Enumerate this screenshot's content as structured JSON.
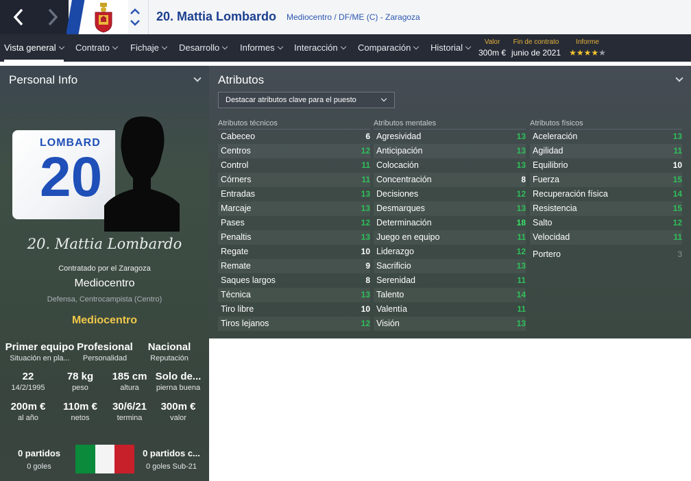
{
  "header": {
    "player_name": "20. Mattia Lombardo",
    "player_sub": "Mediocentro / DF/ME (C) - Zaragoza",
    "back_icon": "chevron-left-icon",
    "forward_icon": "chevron-right-icon",
    "crest_icon": "club-crest-icon",
    "colors": {
      "club_blue": "#1b49a8",
      "name_blue": "#1b3f8f"
    }
  },
  "menu": {
    "items": [
      {
        "label": "Vista general",
        "active": true
      },
      {
        "label": "Contrato"
      },
      {
        "label": "Fichaje"
      },
      {
        "label": "Desarrollo"
      },
      {
        "label": "Informes"
      },
      {
        "label": "Interacción"
      },
      {
        "label": "Comparación"
      },
      {
        "label": "Historial"
      }
    ],
    "stats": {
      "valor_label": "Valor",
      "valor_value": "300m €",
      "contrato_label": "Fin de contrato",
      "contrato_value": "junio de 2021",
      "informe_label": "Informe",
      "informe_stars": 4,
      "informe_stars_max": 5
    }
  },
  "personal": {
    "title": "Personal Info",
    "kit_name": "LOMBARD",
    "kit_number": "20",
    "signature": "20. Mattia Lombardo",
    "contracted_by": "Contratado por el Zaragoza",
    "role": "Mediocentro",
    "positions": "Defensa, Centrocampista (Centro)",
    "best_role": "Mediocentro",
    "row1": [
      {
        "big": "Primer equipo",
        "small": "Situación en pla..."
      },
      {
        "big": "Profesional",
        "small": "Personalidad"
      },
      {
        "big": "Nacional",
        "small": "Reputación"
      }
    ],
    "row2": [
      {
        "big": "22",
        "small": "14/2/1995"
      },
      {
        "big": "78 kg",
        "small": "peso"
      },
      {
        "big": "185 cm",
        "small": "altura"
      },
      {
        "big": "Solo de...",
        "small": "pierna buena"
      }
    ],
    "row3": [
      {
        "big": "200m €",
        "small": "al año"
      },
      {
        "big": "110m €",
        "small": "netos"
      },
      {
        "big": "30/6/21",
        "small": "termina"
      },
      {
        "big": "300m €",
        "small": "valor"
      }
    ],
    "caps": {
      "big": "0 partidos",
      "small": "0 goles"
    },
    "youth_caps": {
      "big": "0 partidos c...",
      "small": "0 goles Sub-21"
    },
    "flag_colors": [
      "#0a8a3a",
      "#f4f4f4",
      "#c8202a"
    ],
    "flag_icon": "italy-flag-icon"
  },
  "attributes": {
    "title": "Atributos",
    "highlight_dropdown": "Destacar atributos clave para el puesto",
    "technical": {
      "heading": "Atributos técnicos",
      "rows": [
        {
          "name": "Cabeceo",
          "value": "6"
        },
        {
          "name": "Centros",
          "value": "12"
        },
        {
          "name": "Control",
          "value": "11"
        },
        {
          "name": "Córners",
          "value": "11"
        },
        {
          "name": "Entradas",
          "value": "13"
        },
        {
          "name": "Marcaje",
          "value": "13"
        },
        {
          "name": "Pases",
          "value": "12"
        },
        {
          "name": "Penaltis",
          "value": "13"
        },
        {
          "name": "Regate",
          "value": "10"
        },
        {
          "name": "Remate",
          "value": "9"
        },
        {
          "name": "Saques largos",
          "value": "8"
        },
        {
          "name": "Técnica",
          "value": "13"
        },
        {
          "name": "Tiro libre",
          "value": "10"
        },
        {
          "name": "Tiros lejanos",
          "value": "12"
        }
      ]
    },
    "mental": {
      "heading": "Atributos mentales",
      "rows": [
        {
          "name": "Agresividad",
          "value": "13"
        },
        {
          "name": "Anticipación",
          "value": "13"
        },
        {
          "name": "Colocación",
          "value": "13"
        },
        {
          "name": "Concentración",
          "value": "8"
        },
        {
          "name": "Decisiones",
          "value": "12"
        },
        {
          "name": "Desmarques",
          "value": "13"
        },
        {
          "name": "Determinación",
          "value": "18"
        },
        {
          "name": "Juego en equipo",
          "value": "11"
        },
        {
          "name": "Liderazgo",
          "value": "12"
        },
        {
          "name": "Sacrificio",
          "value": "13"
        },
        {
          "name": "Serenidad",
          "value": "11"
        },
        {
          "name": "Talento",
          "value": "14"
        },
        {
          "name": "Valentía",
          "value": "11"
        },
        {
          "name": "Visión",
          "value": "13"
        }
      ]
    },
    "physical": {
      "heading": "Atributos físicos",
      "rows": [
        {
          "name": "Aceleración",
          "value": "13"
        },
        {
          "name": "Agilidad",
          "value": "11"
        },
        {
          "name": "Equilibrio",
          "value": "10"
        },
        {
          "name": "Fuerza",
          "value": "15"
        },
        {
          "name": "Recuperación física",
          "value": "14"
        },
        {
          "name": "Resistencia",
          "value": "15"
        },
        {
          "name": "Salto",
          "value": "12"
        },
        {
          "name": "Velocidad",
          "value": "11"
        }
      ],
      "goalkeeper": {
        "name": "Portero",
        "value": "3"
      }
    }
  }
}
